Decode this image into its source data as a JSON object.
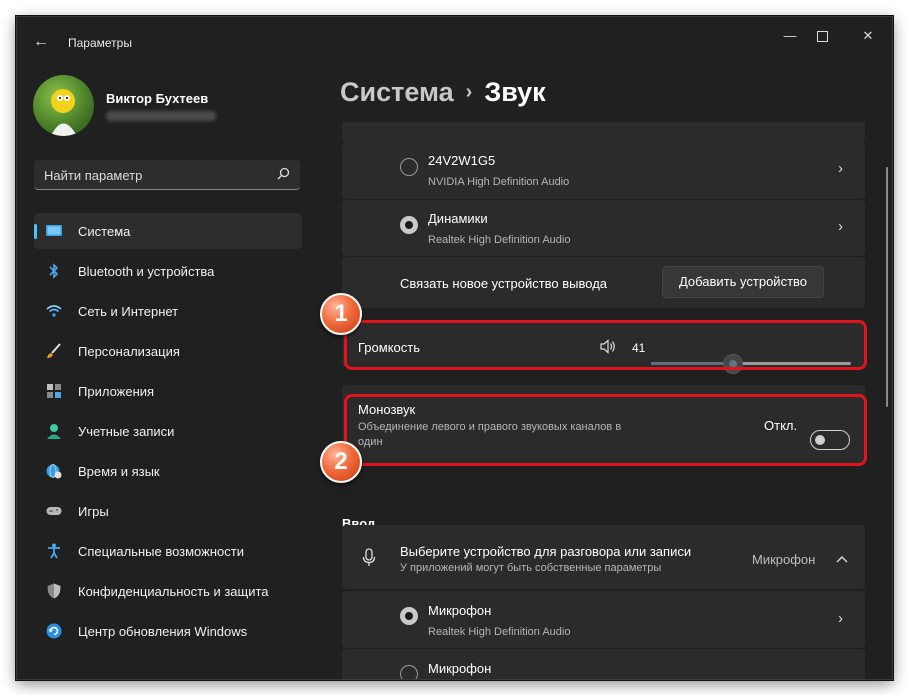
{
  "window": {
    "title": "Параметры",
    "back_icon": "←",
    "minimize_icon": "—",
    "close_icon": "✕"
  },
  "profile": {
    "name": "Виктор Бухтеев"
  },
  "search": {
    "placeholder": "Найти параметр"
  },
  "nav": [
    {
      "label": "Система",
      "icon": "system-display-icon",
      "active": true
    },
    {
      "label": "Bluetooth и устройства",
      "icon": "bluetooth-icon"
    },
    {
      "label": "Сеть и Интернет",
      "icon": "wifi-icon"
    },
    {
      "label": "Персонализация",
      "icon": "brush-icon"
    },
    {
      "label": "Приложения",
      "icon": "apps-icon"
    },
    {
      "label": "Учетные записи",
      "icon": "account-icon"
    },
    {
      "label": "Время и язык",
      "icon": "globe-clock-icon"
    },
    {
      "label": "Игры",
      "icon": "gamepad-icon"
    },
    {
      "label": "Специальные возможности",
      "icon": "accessibility-icon"
    },
    {
      "label": "Конфиденциальность и защита",
      "icon": "shield-icon"
    },
    {
      "label": "Центр обновления Windows",
      "icon": "update-icon"
    }
  ],
  "breadcrumb": {
    "parent": "Система",
    "separator": "›",
    "current": "Звук"
  },
  "output": {
    "devices": [
      {
        "name": "24V2W1G5",
        "driver": "NVIDIA High Definition Audio",
        "selected": false
      },
      {
        "name": "Динамики",
        "driver": "Realtek High Definition Audio",
        "selected": true
      }
    ],
    "pair_label": "Связать новое устройство вывода",
    "add_button": "Добавить устройство"
  },
  "volume": {
    "label": "Громкость",
    "value": "41",
    "level_percent": 41
  },
  "mono": {
    "title": "Монозвук",
    "description_line1": "Объединение левого и правого звуковых каналов в",
    "description_line2": "один",
    "state": "Откл."
  },
  "input": {
    "section_title": "Ввод",
    "header_title": "Выберите устройство для разговора или записи",
    "header_sub": "У приложений могут быть собственные параметры",
    "current": "Микрофон",
    "devices": [
      {
        "name": "Микрофон",
        "driver": "Realtek High Definition Audio",
        "selected": true
      },
      {
        "name": "Микрофон",
        "selected": false
      }
    ]
  },
  "badges": [
    "1",
    "2"
  ],
  "colors": {
    "accent": "#4cc2ff",
    "highlight": "#e0141b",
    "background": "#202020",
    "card": "#2b2b2b"
  }
}
